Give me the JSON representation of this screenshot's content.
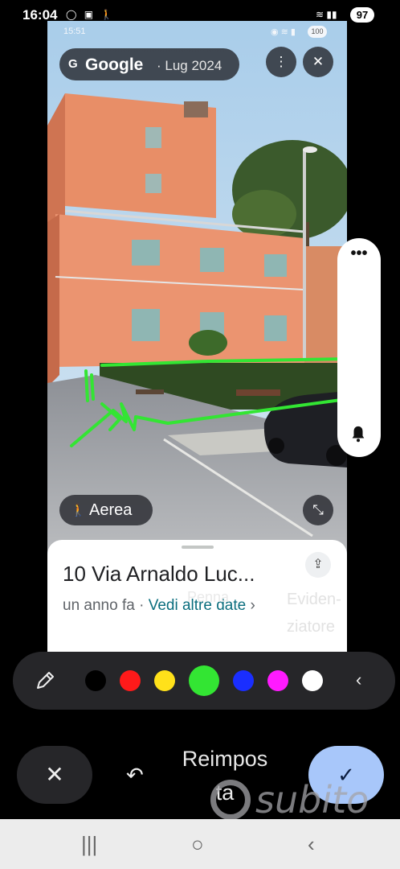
{
  "status_bar": {
    "time": "16:04",
    "left_icons": "◯ ▣ 🚶",
    "right_icons": "≋ ▮▮",
    "battery": "97"
  },
  "screenshot": {
    "inner_status": {
      "time": "15:51",
      "right_icons": "◉ ≋ ▮",
      "battery": "100"
    },
    "google_pill": {
      "logo_letter": "G",
      "title": "Google",
      "date": "· Lug 2024"
    },
    "more_icon": "⋮",
    "close_icon": "✕",
    "aerea_label": "Aerea",
    "card": {
      "address": "10 Via Arnaldo Luc...",
      "time_ago": "un anno fa ·",
      "more_dates": "Vedi altre date",
      "arrow": "›"
    }
  },
  "overlay_labels": {
    "penna": "Penna",
    "evidenziatore": "Eviden-\nziatore"
  },
  "side_panel": {
    "more": "•••",
    "bell_icon": "bell-icon"
  },
  "pen_bar": {
    "pen_icon": "pen-icon",
    "colors": [
      "#000000",
      "#ff1a1a",
      "#ffe11a",
      "#33e533",
      "#1a2eff",
      "#ff1aff",
      "#ffffff"
    ],
    "selected_color": "#33e533",
    "collapse": "‹"
  },
  "actions": {
    "cancel": "✕",
    "undo": "↶",
    "reset": "Reimpos\nta",
    "confirm": "✓"
  },
  "watermark": "subito",
  "nav_bar": {
    "recents": "|||",
    "home": "○",
    "back": "‹"
  }
}
